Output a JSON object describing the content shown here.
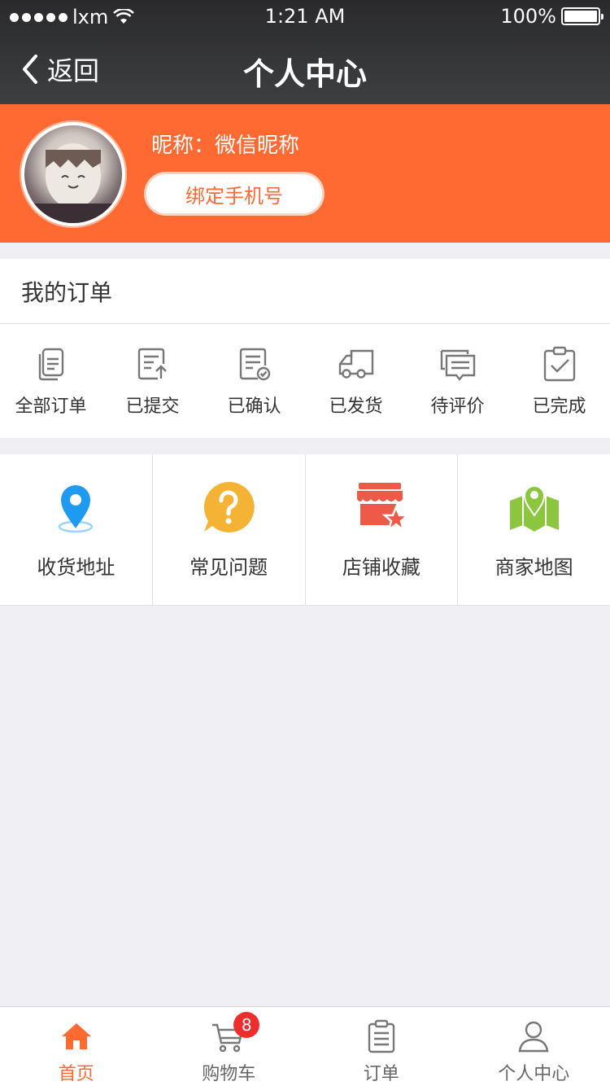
{
  "status_bar": {
    "carrier": "lxm",
    "time": "1:21 AM",
    "battery": "100%"
  },
  "nav": {
    "back_label": "返回",
    "title": "个人中心"
  },
  "profile": {
    "nickname": "昵称：微信昵称",
    "bind_phone_label": "绑定手机号"
  },
  "orders": {
    "heading": "我的订单",
    "items": [
      {
        "label": "全部订单",
        "icon": "all-orders-icon"
      },
      {
        "label": "已提交",
        "icon": "submitted-icon"
      },
      {
        "label": "已确认",
        "icon": "confirmed-icon"
      },
      {
        "label": "已发货",
        "icon": "shipped-truck-icon"
      },
      {
        "label": "待评价",
        "icon": "review-chat-icon"
      },
      {
        "label": "已完成",
        "icon": "completed-clipboard-icon"
      }
    ]
  },
  "services": {
    "items": [
      {
        "label": "收货地址",
        "icon": "location-pin-icon",
        "color": "#1e9bf0"
      },
      {
        "label": "常见问题",
        "icon": "question-bubble-icon",
        "color": "#f5b335"
      },
      {
        "label": "店铺收藏",
        "icon": "store-star-icon",
        "color": "#ee5a47"
      },
      {
        "label": "商家地图",
        "icon": "map-icon",
        "color": "#8cc63f"
      }
    ]
  },
  "tabbar": {
    "items": [
      {
        "label": "首页",
        "icon": "home-icon",
        "active": true
      },
      {
        "label": "购物车",
        "icon": "cart-icon",
        "badge": "8"
      },
      {
        "label": "订单",
        "icon": "clipboard-icon"
      },
      {
        "label": "个人中心",
        "icon": "user-icon"
      }
    ]
  },
  "colors": {
    "accent": "#ff6a33",
    "navbar": "#333436",
    "badge": "#f02d2d"
  }
}
